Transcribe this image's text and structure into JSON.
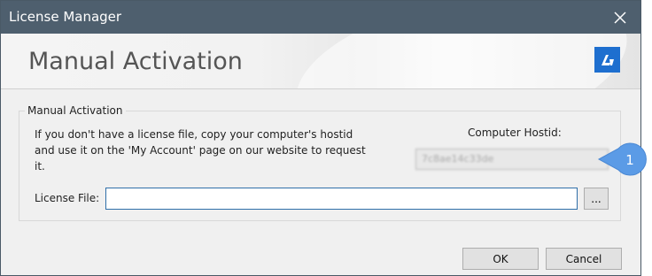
{
  "window": {
    "title": "License Manager"
  },
  "header": {
    "title": "Manual Activation",
    "logo_glyph": "ﾀ",
    "logo_color": "#1e6fcf"
  },
  "group": {
    "legend": "Manual Activation",
    "info_text": "If you don't have a license file, copy your computer's hostid and use it on the 'My Account' page on our website to request it.",
    "hostid_label": "Computer Hostid:",
    "hostid_value": "7c8ae14c33de"
  },
  "license_file": {
    "label": "License File:",
    "value": "",
    "browse_label": "..."
  },
  "buttons": {
    "ok": "OK",
    "cancel": "Cancel"
  },
  "callout": {
    "number": "1",
    "color": "#5b9be6"
  },
  "icons": {
    "close": "close-icon",
    "logo": "bricscad-logo-icon"
  }
}
